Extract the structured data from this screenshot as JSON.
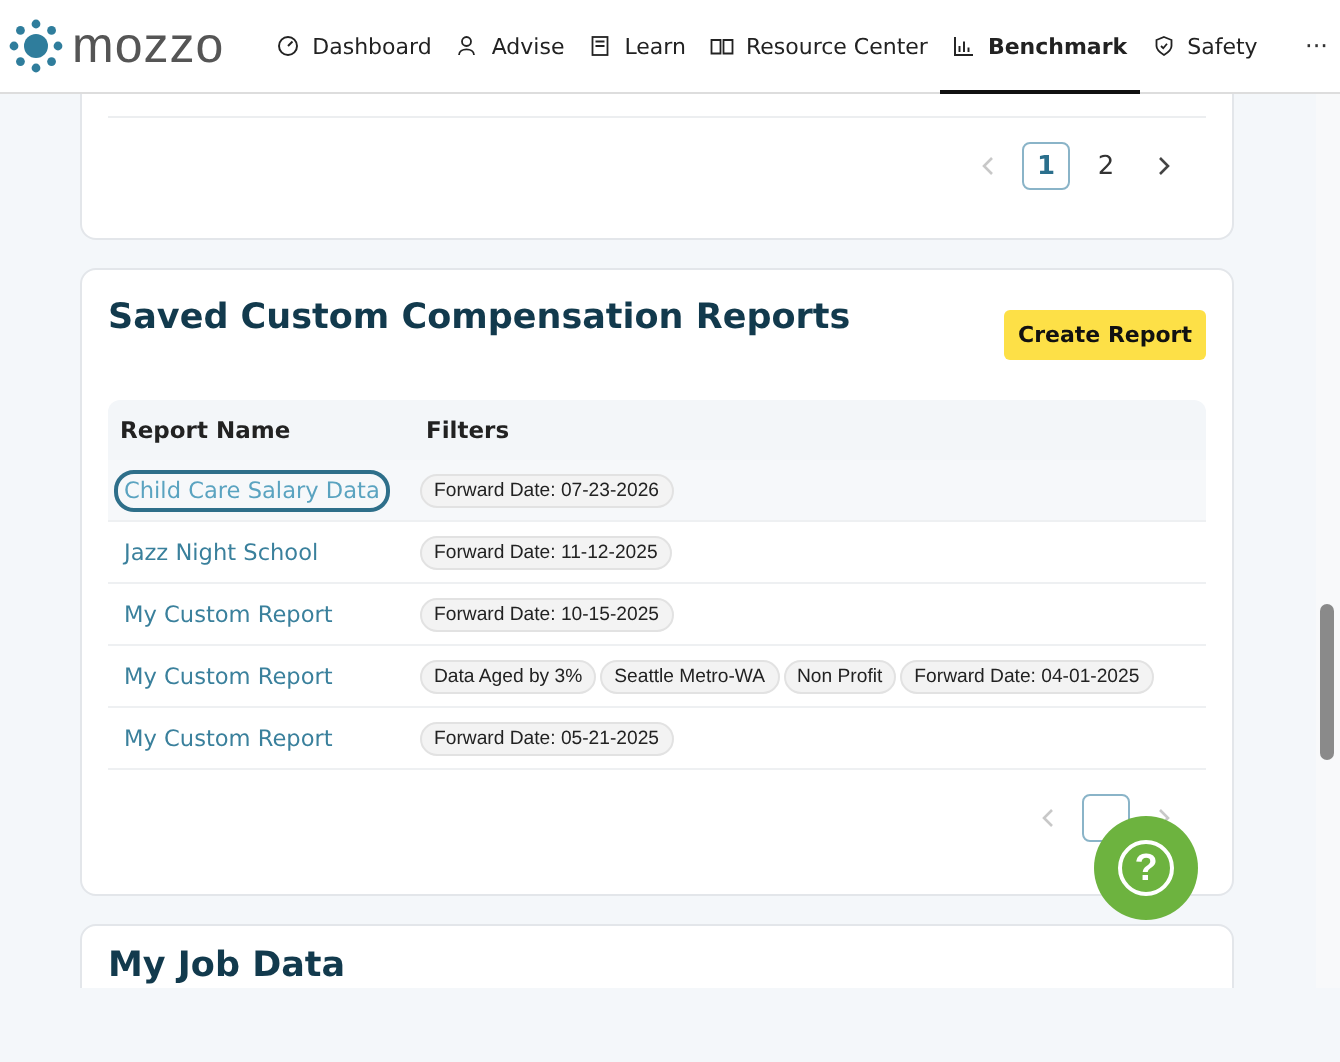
{
  "nav": {
    "logo": "mozzo",
    "items": [
      {
        "label": "Dashboard",
        "kind": "gauge",
        "selected": false
      },
      {
        "label": "Advise",
        "kind": "people",
        "selected": false
      },
      {
        "label": "Learn",
        "kind": "doc",
        "selected": false
      },
      {
        "label": "Resource Center",
        "kind": "book",
        "selected": false
      },
      {
        "label": "Benchmark",
        "kind": "chart",
        "selected": true
      },
      {
        "label": "Safety",
        "kind": "shield",
        "selected": false
      }
    ],
    "more": "···"
  },
  "top_card": {
    "pagination": {
      "pages": [
        {
          "label": "1",
          "selected": true
        },
        {
          "label": "2",
          "selected": false
        }
      ],
      "prev_disabled": true,
      "next_disabled": false
    }
  },
  "reports_card": {
    "title": "Saved Custom Compensation Reports",
    "create_button": "Create Report",
    "table": {
      "columns": [
        "Report Name",
        "Filters"
      ],
      "rows": [
        {
          "name": "Child Care Salary Data",
          "focused": true,
          "filters": [
            "Forward Date: 07-23-2026"
          ]
        },
        {
          "name": "Jazz Night School",
          "focused": false,
          "filters": [
            "Forward Date: 11-12-2025"
          ]
        },
        {
          "name": "My Custom Report",
          "focused": false,
          "filters": [
            "Forward Date: 10-15-2025"
          ]
        },
        {
          "name": "My Custom Report",
          "focused": false,
          "filters": [
            "Data Aged by 3%",
            "Seattle Metro-WA",
            "Non Profit",
            "Forward Date: 04-01-2025"
          ]
        },
        {
          "name": "My Custom Report",
          "focused": false,
          "filters": [
            "Forward Date: 05-21-2025"
          ]
        }
      ]
    },
    "pagination": {
      "pages": [
        {
          "selected": true
        }
      ],
      "prev_disabled": true,
      "next_disabled": true
    }
  },
  "job_card": {
    "title": "My Job Data"
  },
  "help_button": {
    "label": "?"
  }
}
